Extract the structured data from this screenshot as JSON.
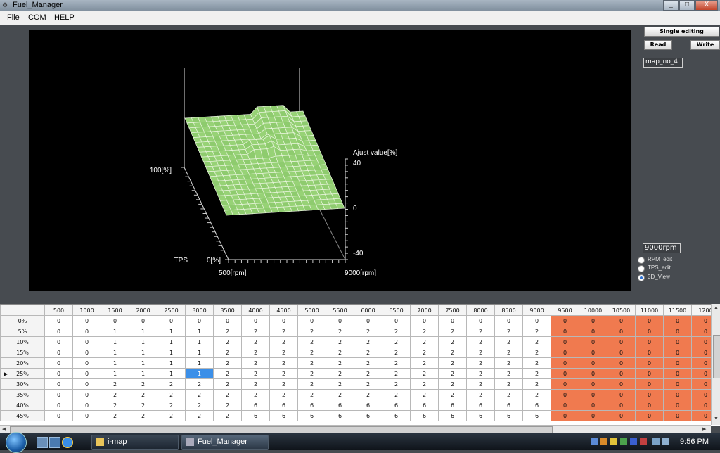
{
  "window": {
    "title": "Fuel_Manager",
    "controls": [
      "_",
      "□",
      "X"
    ]
  },
  "menu": [
    "File",
    "COM",
    "HELP"
  ],
  "panel": {
    "single_editing": "Single editing",
    "read": "Read",
    "write": "Write",
    "map_name": "map_no_4",
    "rpm_value": "9000rpm",
    "modes": [
      {
        "label": "RPM_edit",
        "selected": false
      },
      {
        "label": "TPS_edit",
        "selected": false
      },
      {
        "label": "3D_View",
        "selected": true
      }
    ]
  },
  "view3d": {
    "z_axis_label": "Ajust value[%]",
    "z_ticks": [
      "40",
      "0",
      "-40"
    ],
    "tps_label": "TPS",
    "tps_max": "100[%]",
    "tps_min": "0[%]",
    "rpm_min": "500[rpm]",
    "rpm_max": "9000[rpm]"
  },
  "table": {
    "columns": [
      "500",
      "1000",
      "1500",
      "2000",
      "2500",
      "3000",
      "3500",
      "4000",
      "4500",
      "5000",
      "5500",
      "6000",
      "6500",
      "7000",
      "7500",
      "8000",
      "8500",
      "9000",
      "9500",
      "10000",
      "10500",
      "11000",
      "11500",
      "1200"
    ],
    "rows": [
      {
        "label": "0%",
        "values": [
          "0",
          "0",
          "0",
          "0",
          "0",
          "0",
          "0",
          "0",
          "0",
          "0",
          "0",
          "0",
          "0",
          "0",
          "0",
          "0",
          "0",
          "0",
          "0",
          "0",
          "0",
          "0",
          "0",
          "0"
        ]
      },
      {
        "label": "5%",
        "values": [
          "0",
          "0",
          "1",
          "1",
          "1",
          "1",
          "2",
          "2",
          "2",
          "2",
          "2",
          "2",
          "2",
          "2",
          "2",
          "2",
          "2",
          "2",
          "0",
          "0",
          "0",
          "0",
          "0",
          "0"
        ]
      },
      {
        "label": "10%",
        "values": [
          "0",
          "0",
          "1",
          "1",
          "1",
          "1",
          "2",
          "2",
          "2",
          "2",
          "2",
          "2",
          "2",
          "2",
          "2",
          "2",
          "2",
          "2",
          "0",
          "0",
          "0",
          "0",
          "0",
          "0"
        ]
      },
      {
        "label": "15%",
        "values": [
          "0",
          "0",
          "1",
          "1",
          "1",
          "1",
          "2",
          "2",
          "2",
          "2",
          "2",
          "2",
          "2",
          "2",
          "2",
          "2",
          "2",
          "2",
          "0",
          "0",
          "0",
          "0",
          "0",
          "0"
        ]
      },
      {
        "label": "20%",
        "values": [
          "0",
          "0",
          "1",
          "1",
          "1",
          "1",
          "2",
          "2",
          "2",
          "2",
          "2",
          "2",
          "2",
          "2",
          "2",
          "2",
          "2",
          "2",
          "0",
          "0",
          "0",
          "0",
          "0",
          "0"
        ]
      },
      {
        "label": "25%",
        "values": [
          "0",
          "0",
          "1",
          "1",
          "1",
          "1",
          "2",
          "2",
          "2",
          "2",
          "2",
          "2",
          "2",
          "2",
          "2",
          "2",
          "2",
          "2",
          "0",
          "0",
          "0",
          "0",
          "0",
          "0"
        ]
      },
      {
        "label": "30%",
        "values": [
          "0",
          "0",
          "2",
          "2",
          "2",
          "2",
          "2",
          "2",
          "2",
          "2",
          "2",
          "2",
          "2",
          "2",
          "2",
          "2",
          "2",
          "2",
          "0",
          "0",
          "0",
          "0",
          "0",
          "0"
        ]
      },
      {
        "label": "35%",
        "values": [
          "0",
          "0",
          "2",
          "2",
          "2",
          "2",
          "2",
          "2",
          "2",
          "2",
          "2",
          "2",
          "2",
          "2",
          "2",
          "2",
          "2",
          "2",
          "0",
          "0",
          "0",
          "0",
          "0",
          "0"
        ]
      },
      {
        "label": "40%",
        "values": [
          "0",
          "0",
          "2",
          "2",
          "2",
          "2",
          "2",
          "6",
          "6",
          "6",
          "6",
          "6",
          "6",
          "6",
          "6",
          "6",
          "6",
          "6",
          "0",
          "0",
          "0",
          "0",
          "0",
          "0"
        ]
      },
      {
        "label": "45%",
        "values": [
          "0",
          "0",
          "2",
          "2",
          "2",
          "2",
          "2",
          "6",
          "6",
          "6",
          "6",
          "6",
          "6",
          "6",
          "6",
          "6",
          "6",
          "6",
          "0",
          "0",
          "0",
          "0",
          "0",
          "0"
        ]
      }
    ],
    "selected_row": 5,
    "selected_col": 5,
    "hot_from_col": 18
  },
  "taskbar": {
    "buttons": [
      "i-map",
      "Fuel_Manager"
    ],
    "clock": "9:56 PM"
  }
}
